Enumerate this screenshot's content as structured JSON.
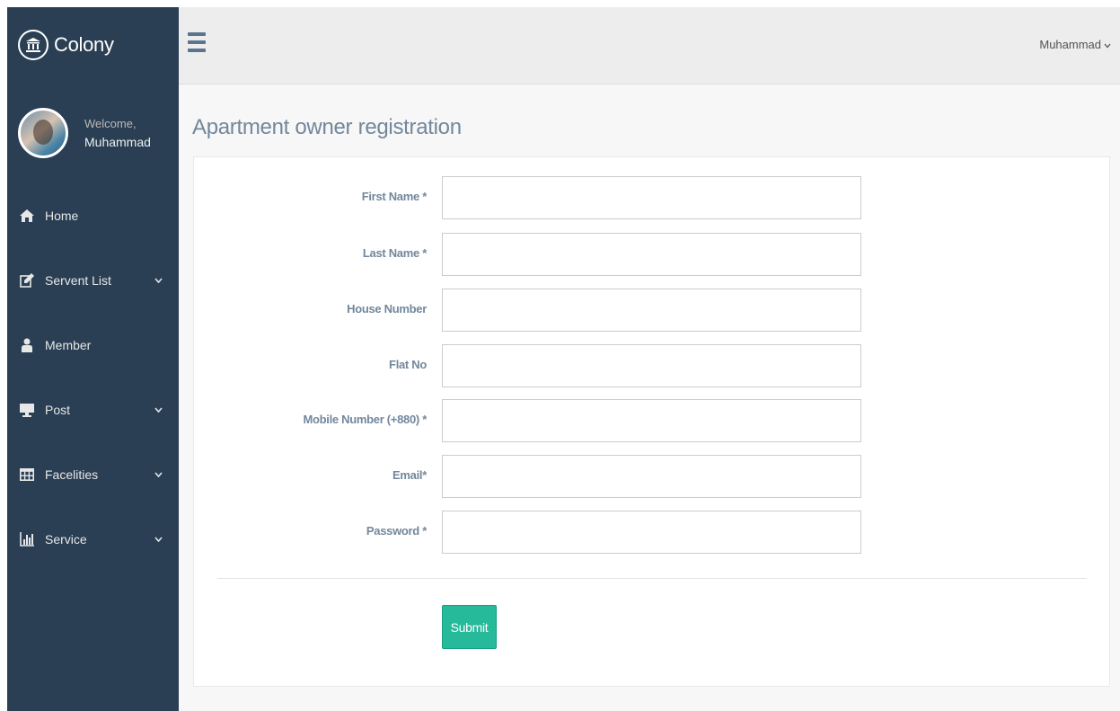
{
  "brand": {
    "title": "Colony",
    "icon": "bank-icon"
  },
  "profile": {
    "welcome": "Welcome,",
    "name": "Muhammad"
  },
  "sidebar": {
    "items": [
      {
        "label": "Home",
        "icon": "home-icon",
        "has_submenu": false
      },
      {
        "label": "Servent List",
        "icon": "edit-icon",
        "has_submenu": true
      },
      {
        "label": "Member",
        "icon": "user-icon",
        "has_submenu": false
      },
      {
        "label": "Post",
        "icon": "desktop-icon",
        "has_submenu": true
      },
      {
        "label": "Facelities",
        "icon": "table-icon",
        "has_submenu": true
      },
      {
        "label": "Service",
        "icon": "bar-chart-icon",
        "has_submenu": true
      }
    ]
  },
  "topbar": {
    "user": "Muhammad",
    "menu_icon": "hamburger-icon"
  },
  "page": {
    "title": "Apartment owner registration"
  },
  "form": {
    "fields": [
      {
        "label": "First Name *",
        "value": "",
        "type": "text"
      },
      {
        "label": "Last Name *",
        "value": "",
        "type": "text"
      },
      {
        "label": "House Number",
        "value": "",
        "type": "text"
      },
      {
        "label": "Flat No",
        "value": "",
        "type": "text"
      },
      {
        "label": "Mobile Number (+880) *",
        "value": "",
        "type": "text"
      },
      {
        "label": "Email*",
        "value": "",
        "type": "email"
      },
      {
        "label": "Password *",
        "value": "",
        "type": "password"
      }
    ],
    "submit_label": "Submit"
  },
  "colors": {
    "sidebar_bg": "#2A3F54",
    "accent": "#26B99A",
    "topbar_bg": "#EDEDED",
    "text": "#73879C"
  }
}
